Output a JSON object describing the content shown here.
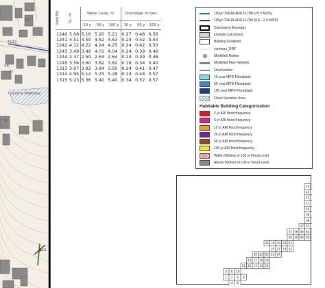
{
  "map": {
    "labels": [
      "71",
      "7429",
      "36",
      "LaLoma Walkway",
      "Cl",
      "G",
      "S16"
    ],
    "colors": {
      "background": "#f3efe6",
      "building": "#8a8a8a",
      "pipe": "#2c5aa8",
      "hatch": "#6b9fd6",
      "overland_flow": "#1f7a2e"
    }
  },
  "results": {
    "headers": {
      "sect_no": "Sect No",
      "gl": "GL, m",
      "water_level": "Water Level, m",
      "discharge": "Discharge, m³/sec"
    },
    "subheaders": [
      "10 y",
      "50 y",
      "100 y",
      "10 y",
      "50 y",
      "100 y"
    ],
    "rows": [
      [
        "1240",
        "5.08",
        "5.18",
        "5.20",
        "5.21",
        "0.27",
        "0.48",
        "0.56"
      ],
      [
        "1241",
        "4.51",
        "4.59",
        "4.62",
        "4.63",
        "0.24",
        "0.42",
        "0.50"
      ],
      [
        "1242",
        "4.12",
        "4.22",
        "4.24",
        "4.25",
        "0.24",
        "0.42",
        "0.50"
      ],
      [
        "1243",
        "3.49",
        "3.49",
        "4.01",
        "4.04",
        "0.24",
        "0.39",
        "0.46"
      ],
      [
        "1244",
        "2.37",
        "2.59",
        "2.63",
        "2.64",
        "0.24",
        "0.39",
        "0.46"
      ],
      [
        "1245",
        "3.56",
        "3.60",
        "3.62",
        "3.62",
        "0.16",
        "0.34",
        "0.40"
      ],
      [
        "1313",
        "3.97",
        "3.92",
        "3.94",
        "3.95",
        "0.24",
        "0.41",
        "0.47"
      ],
      [
        "1314",
        "4.95",
        "5.14",
        "5.25",
        "5.28",
        "0.24",
        "0.48",
        "0.57"
      ],
      [
        "1315",
        "5.23",
        "5.36",
        "5.40",
        "5.40",
        "0.34",
        "0.52",
        "0.57"
      ]
    ]
  },
  "legend": {
    "items": [
      {
        "label": "100yr OVERLAND FLOW (<0.5 M3/S)",
        "icon": "green-line-icon",
        "color": "#1f8a3a"
      },
      {
        "label": "100yr OVERLAND FLOW (0.5 - 2.0 M3/S)",
        "icon": "maroon-line-icon",
        "color": "#8b1a2b"
      },
      {
        "label": "Catchment Boundary",
        "icon": "thick-outline-box-icon",
        "color": "#000000"
      },
      {
        "label": "Outside Catchment",
        "icon": "grey-box-icon",
        "color": "#d3d3d3"
      },
      {
        "label": "Building Footprint",
        "icon": "white-box-icon",
        "color": "#ffffff"
      },
      {
        "label": "contours_DRF",
        "icon": "contour-line-icon",
        "color": "#e3c9a0"
      },
      {
        "label": "Modelled Nodes",
        "icon": "node-dot-icon",
        "color": "#a7a7c8"
      },
      {
        "label": "Modelled Pipe Network",
        "icon": "blue-line-icon",
        "color": "#2c5aa8"
      },
      {
        "label": "FlowSection",
        "icon": "black-line-icon",
        "color": "#000000"
      },
      {
        "label": "10 year MPD Floodplain",
        "icon": "cyan-box-icon",
        "color": "#7fd9f0"
      },
      {
        "label": "50 year MPD Floodplain",
        "icon": "blue-box-icon",
        "color": "#3e86d6"
      },
      {
        "label": "100 year MPD Floodplain",
        "icon": "navy-box-icon",
        "color": "#1d3c8a"
      },
      {
        "label": "Flood Sensitive Area",
        "icon": "hatched-box-icon",
        "color": "#6b9fd6"
      }
    ],
    "section_title": "Habitable Building Categorisation",
    "categories": [
      {
        "label": "2 yr ARI flood frequency",
        "icon": "red-box-icon",
        "color": "#e8141e"
      },
      {
        "label": "5 yr ARI flood frequency",
        "icon": "magenta-box-icon",
        "color": "#e0218a"
      },
      {
        "label": "10 yr ARI flood frequency",
        "icon": "orange-box-icon",
        "color": "#f59a1c"
      },
      {
        "label": "20 yr ARI flood frequency",
        "icon": "purple-box-icon",
        "color": "#7a1fa0"
      },
      {
        "label": "50 yr ARI flood frequency",
        "icon": "brown-box-icon",
        "color": "#8a4b1c"
      },
      {
        "label": "100 yr ARI flood frequency",
        "icon": "yellow-box-icon",
        "color": "#f2ea1a"
      },
      {
        "label": "Within 500mm of 100 yr Flood Level",
        "icon": "red-cross-hatch-icon",
        "color": "#e05a5a"
      },
      {
        "label": "Above 500mm of 100 yr Flood Level",
        "icon": "dark-grey-box-icon",
        "color": "#8a8a8a"
      }
    ]
  },
  "keyplan": {
    "sheets": [
      "44",
      "43",
      "53",
      "42",
      "52",
      "41",
      "51",
      "40",
      "50",
      "39",
      "49",
      "67",
      "38",
      "48",
      "66",
      "37",
      "47",
      "65",
      "31",
      "36",
      "46",
      "64",
      "30",
      "35",
      "45",
      "63",
      "26",
      "28",
      "29",
      "34",
      "62",
      "25",
      "27",
      "33",
      "32",
      "20",
      "21",
      "22",
      "23",
      "24",
      "16",
      "17",
      "18",
      "19",
      "11",
      "12",
      "13",
      "14",
      "15",
      "3",
      "6",
      "10",
      "1",
      "2",
      "5",
      "9",
      "4",
      "8",
      "7"
    ],
    "highlighted_sheet": "2",
    "highlight_color": "#e8141e"
  }
}
